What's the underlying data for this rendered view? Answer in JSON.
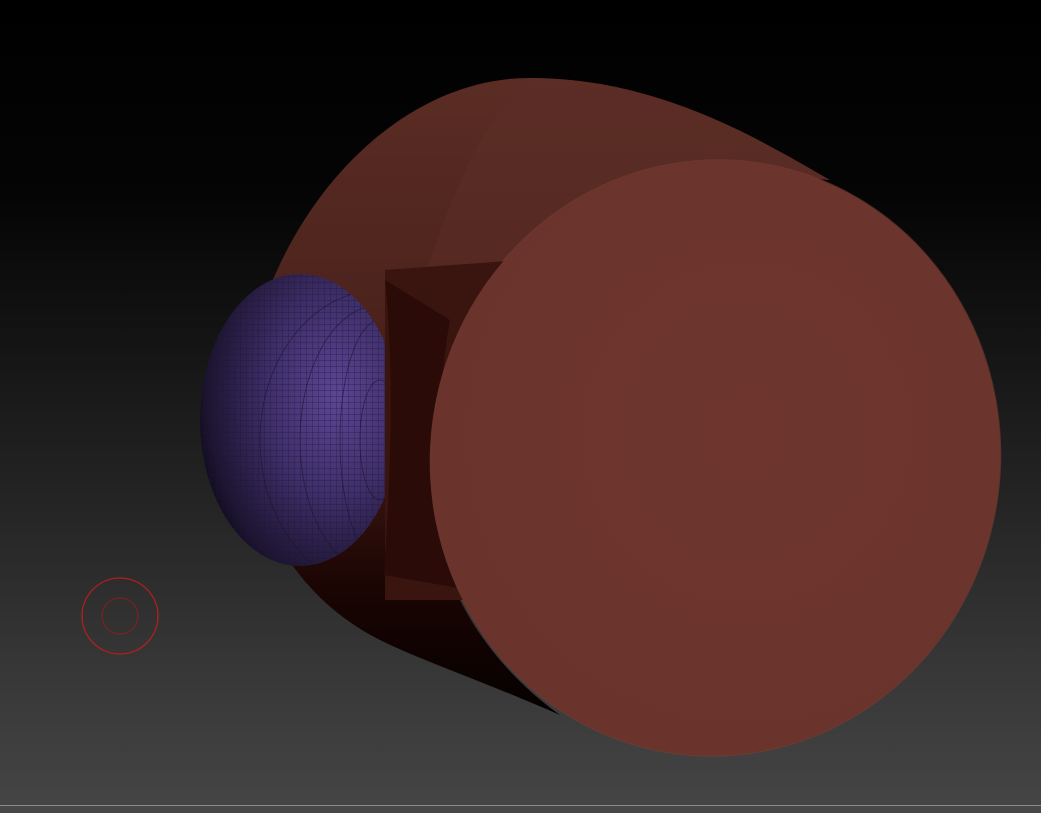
{
  "canvas": {
    "background_top": "#000000",
    "background_bottom": "#444444"
  },
  "subtools": [
    {
      "name": "cylinder",
      "material_color": "#6b352d",
      "side_color": "#532922"
    },
    {
      "name": "sphere",
      "material_color": "#5b4694",
      "wire_color": "#1f1430"
    }
  ],
  "brush_cursor": {
    "color": "#b0201c",
    "icon": "draw-size-circle"
  },
  "icons": {
    "brush_cursor": "brush-cursor-icon"
  }
}
